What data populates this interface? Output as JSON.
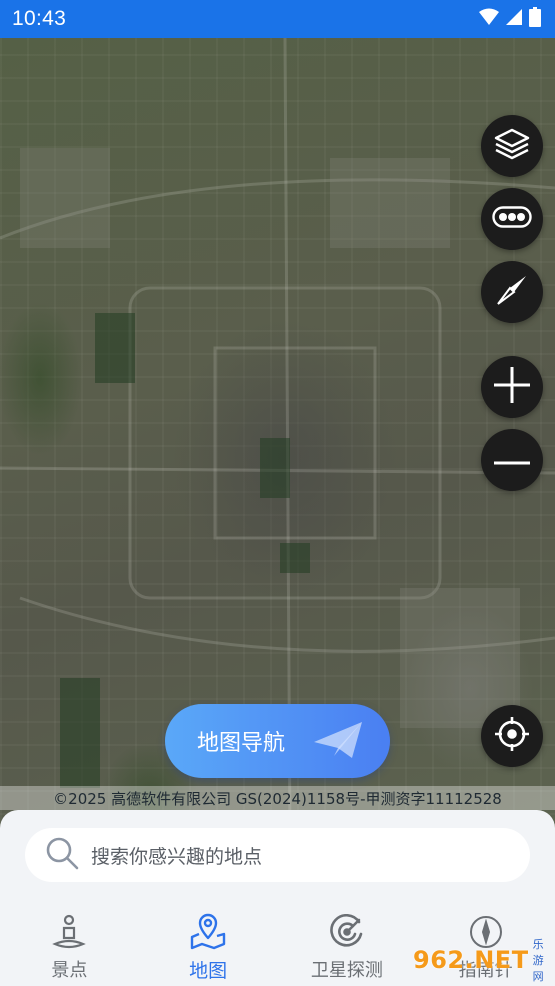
{
  "status_bar": {
    "time": "10:43"
  },
  "map": {
    "layers_icon": "layers-icon",
    "traffic_icon": "traffic-icon",
    "compass_icon": "compass-icon",
    "zoom_in_icon": "plus-icon",
    "zoom_out_icon": "minus-icon",
    "locate_icon": "crosshair-icon"
  },
  "nav_button": {
    "label": "地图导航"
  },
  "copyright": "©2025 高德软件有限公司 GS(2024)1158号-甲测资字11112528",
  "search": {
    "placeholder": "搜索你感兴趣的地点"
  },
  "tabs": [
    {
      "label": "景点",
      "icon": "landmark-icon"
    },
    {
      "label": "地图",
      "icon": "map-pin-icon",
      "active": true
    },
    {
      "label": "卫星探测",
      "icon": "radar-icon"
    },
    {
      "label": "指南针",
      "icon": "compass-icon"
    }
  ],
  "watermark": {
    "brand": "962.NET",
    "sub": "乐游网"
  },
  "colors": {
    "status_bar": "#1a73e8",
    "accent": "#2e73ea"
  }
}
